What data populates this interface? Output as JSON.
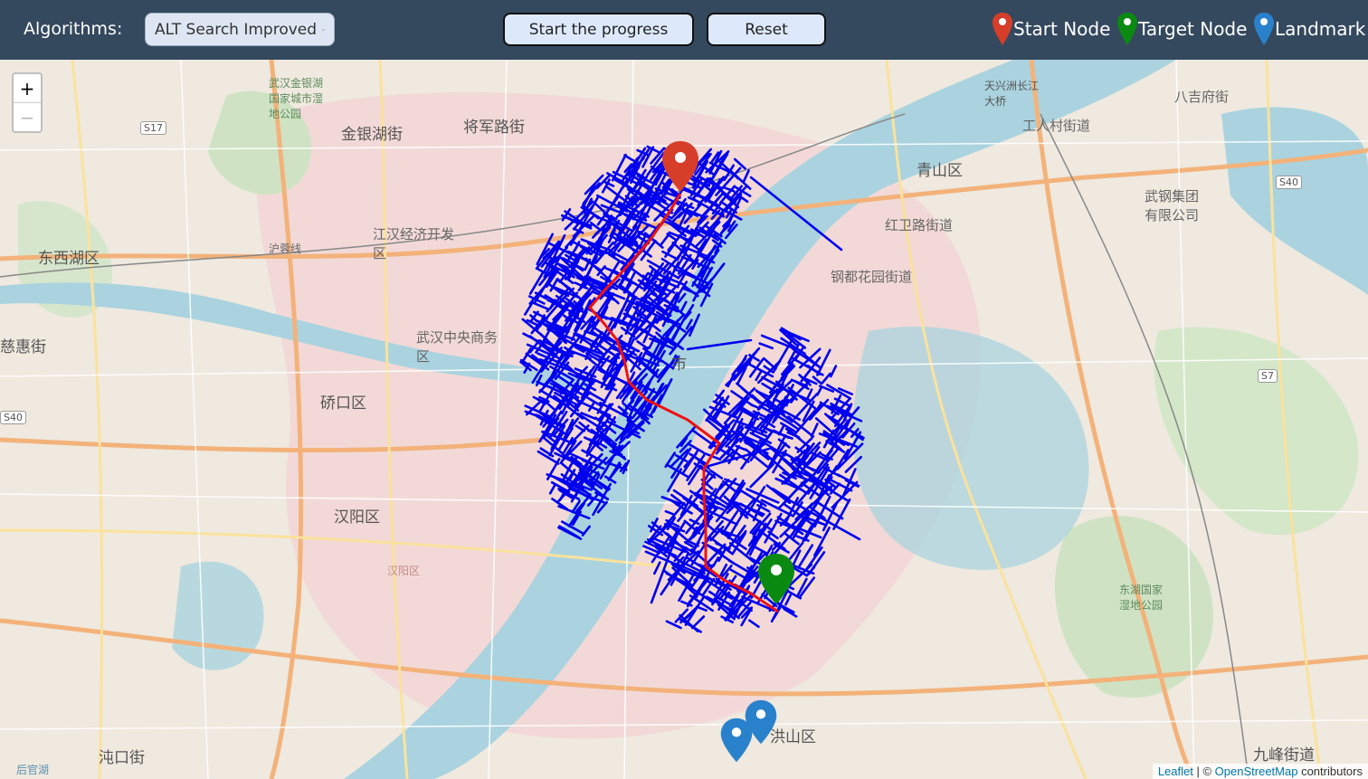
{
  "toolbar": {
    "algorithms_label": "Algorithms:",
    "algorithm_selected": "ALT Search Improved",
    "start_button": "Start the progress",
    "reset_button": "Reset"
  },
  "legend": {
    "start": "Start Node",
    "target": "Target Node",
    "landmark": "Landmark"
  },
  "colors": {
    "topbar": "#34495e",
    "start_marker": "#d63e2a",
    "target_marker": "#0b8a12",
    "landmark_marker": "#2a81cb",
    "explored_edges": "#0000ee",
    "path": "#ee1111"
  },
  "zoom": {
    "in": "+",
    "out": "−"
  },
  "attribution": {
    "leaflet": "Leaflet",
    "sep": " | © ",
    "osm": "OpenStreetMap",
    "suffix": " contributors"
  },
  "map_labels": {
    "l1": "武汉金银湖国家城市湿地公园",
    "l2": "金银湖街",
    "l3": "将军路街",
    "l4": "东西湖区",
    "l5": "江汉经济开发区",
    "l6": "武汉中央商务区",
    "l7": "硚口区",
    "l8": "慈惠街",
    "l9": "汉阳区",
    "l10": "洪山区",
    "l11": "沌口街",
    "l12": "九峰街道",
    "l13": "青山区",
    "l14": "红卫路街道",
    "l15": "钢都花园街道",
    "l16": "工人村街道",
    "l17": "八吉府街",
    "l18": "武钢集团有限公司",
    "l19": "东湖国家湿地公园",
    "l20": "天兴洲长江大桥",
    "l21": "市",
    "l22": "汉阳区",
    "l23": "后官湖",
    "l24": "S17",
    "l25": "S40",
    "l26": "S40",
    "l27": "S7",
    "l28": "沪蓉线"
  }
}
